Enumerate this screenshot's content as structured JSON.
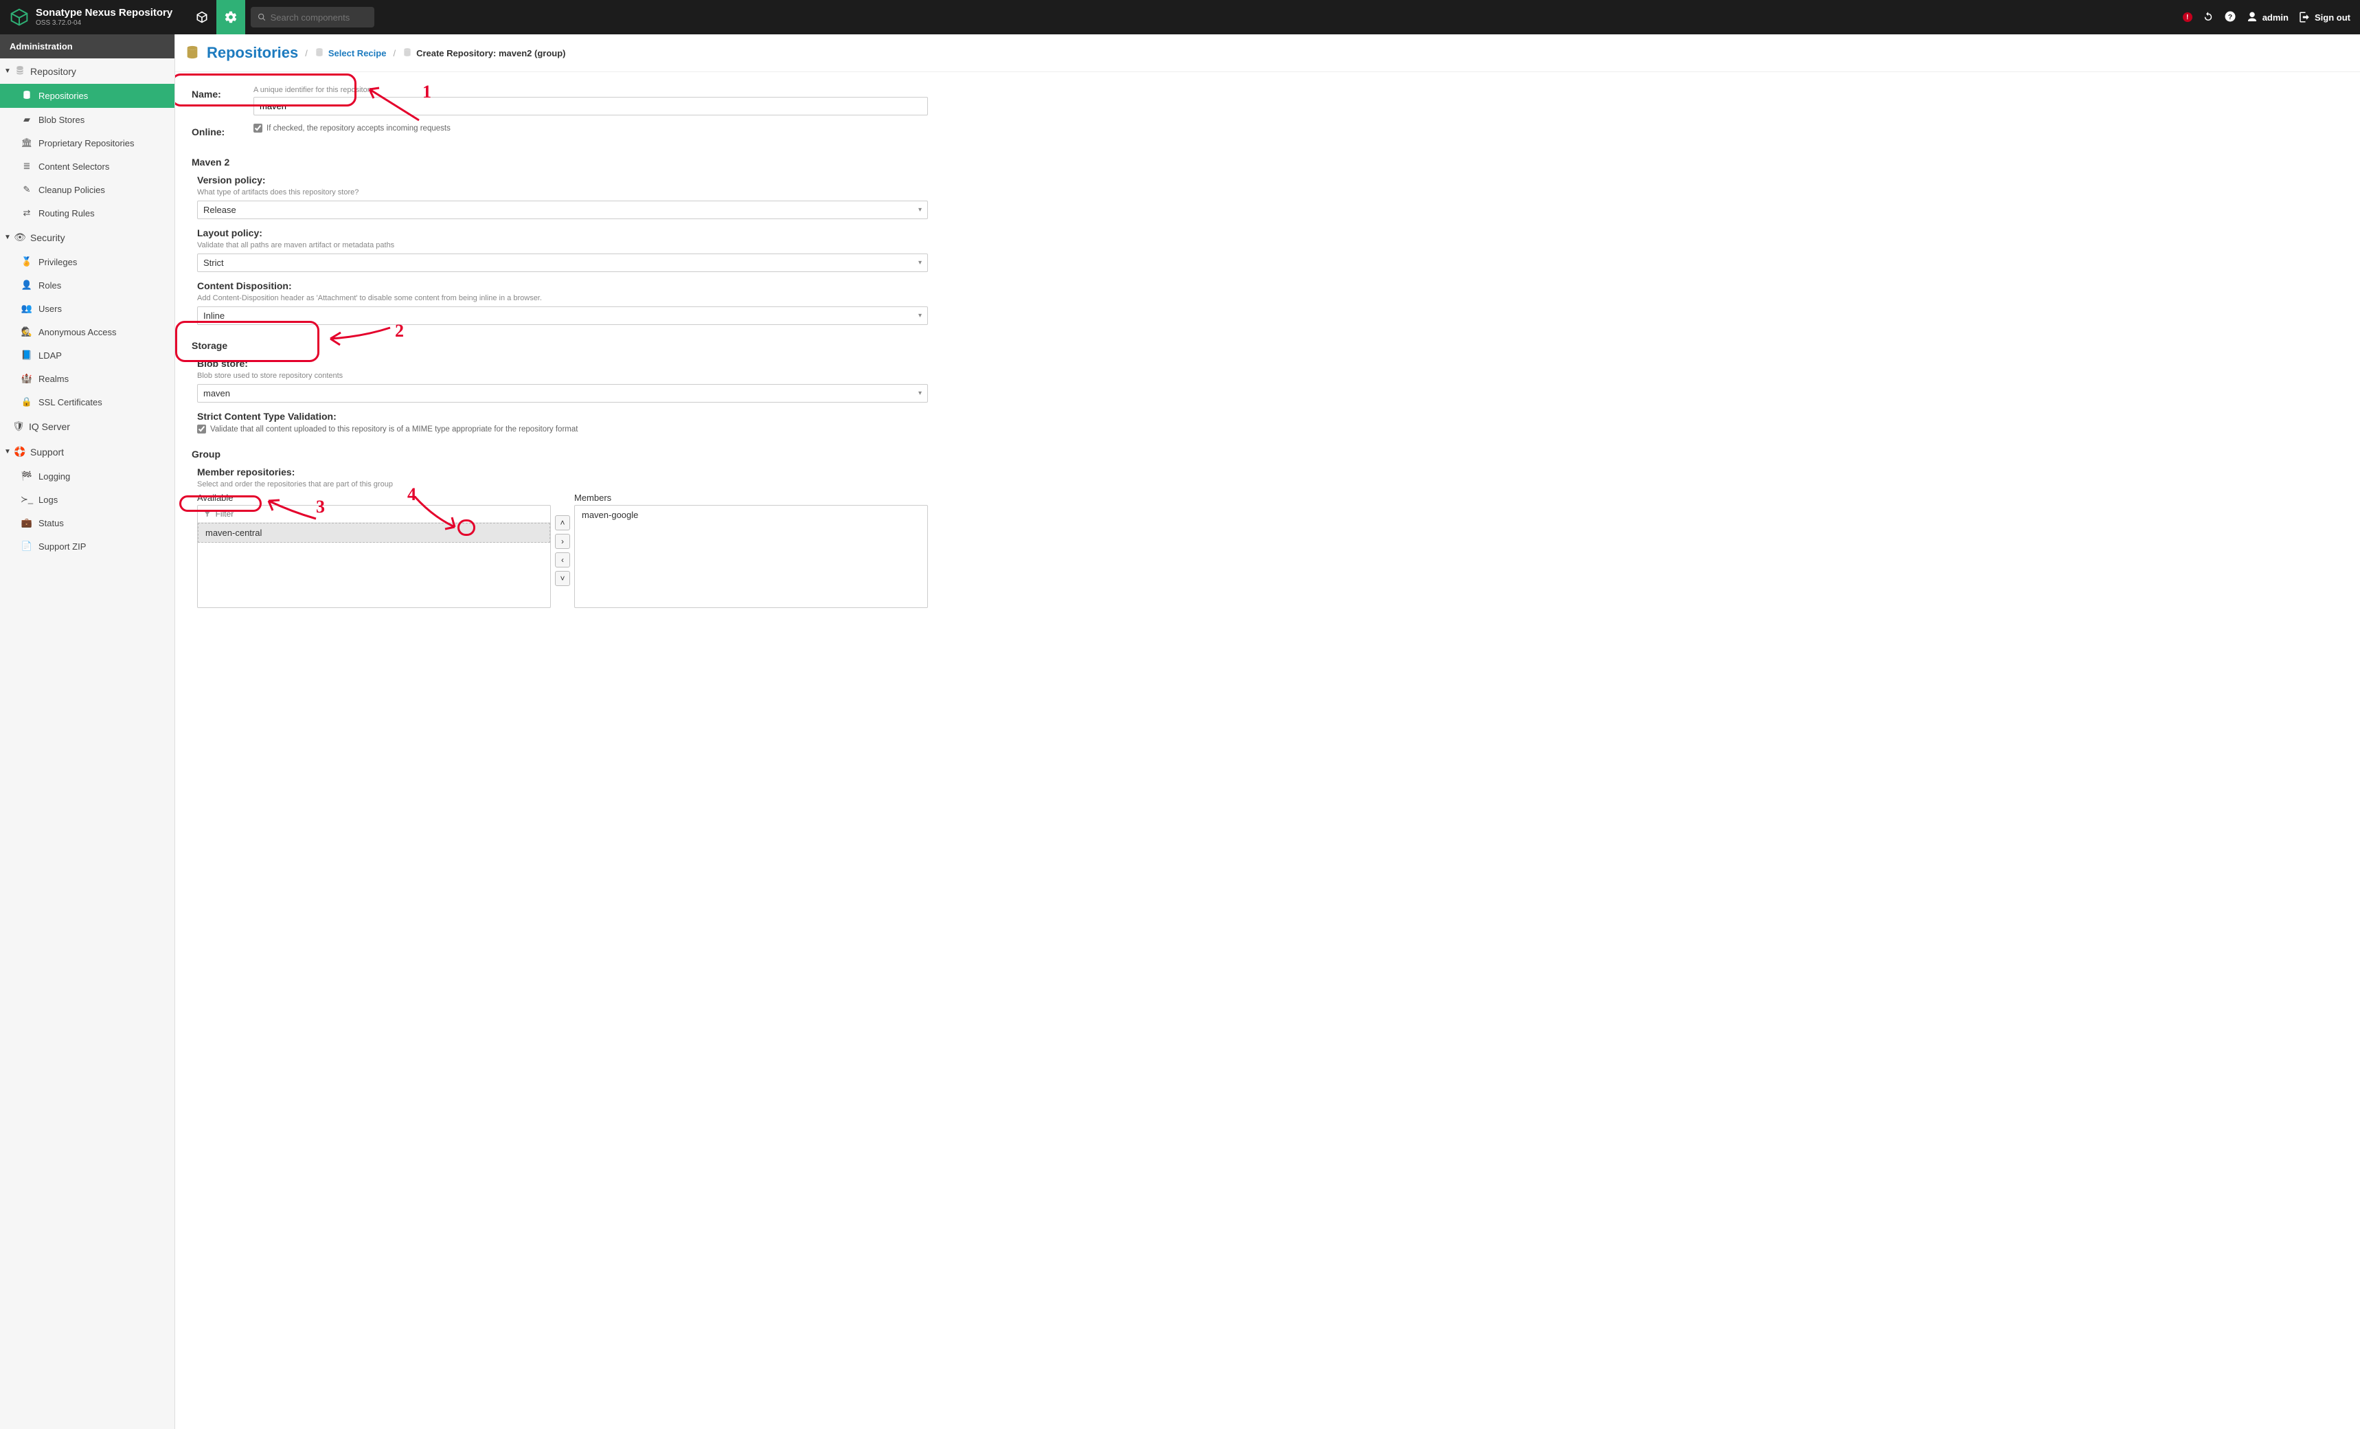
{
  "header": {
    "product_title": "Sonatype Nexus Repository",
    "product_version": "OSS 3.72.0-04",
    "search_placeholder": "Search components",
    "user_label": "admin",
    "signout_label": "Sign out"
  },
  "sidebar": {
    "title": "Administration",
    "groups": [
      {
        "label": "Repository",
        "expanded": true,
        "items": [
          {
            "id": "repositories",
            "label": "Repositories",
            "active": true
          },
          {
            "id": "blob-stores",
            "label": "Blob Stores"
          },
          {
            "id": "proprietary",
            "label": "Proprietary Repositories"
          },
          {
            "id": "content-sel",
            "label": "Content Selectors"
          },
          {
            "id": "cleanup",
            "label": "Cleanup Policies"
          },
          {
            "id": "routing",
            "label": "Routing Rules"
          }
        ]
      },
      {
        "label": "Security",
        "expanded": true,
        "items": [
          {
            "id": "privileges",
            "label": "Privileges"
          },
          {
            "id": "roles",
            "label": "Roles"
          },
          {
            "id": "users",
            "label": "Users"
          },
          {
            "id": "anon",
            "label": "Anonymous Access"
          },
          {
            "id": "ldap",
            "label": "LDAP"
          },
          {
            "id": "realms",
            "label": "Realms"
          },
          {
            "id": "sslcerts",
            "label": "SSL Certificates"
          }
        ]
      },
      {
        "label": "IQ Server",
        "expanded": false,
        "items": []
      },
      {
        "label": "Support",
        "expanded": true,
        "items": [
          {
            "id": "logging",
            "label": "Logging"
          },
          {
            "id": "logs",
            "label": "Logs"
          },
          {
            "id": "status",
            "label": "Status"
          },
          {
            "id": "support-zip",
            "label": "Support ZIP"
          }
        ]
      }
    ]
  },
  "breadcrumb": {
    "main": "Repositories",
    "crumb1": "Select Recipe",
    "crumb2": "Create Repository: maven2 (group)"
  },
  "form": {
    "name_label": "Name:",
    "name_hint": "A unique identifier for this repository",
    "name_value": "maven",
    "online_label": "Online:",
    "online_hint": "If checked, the repository accepts incoming requests",
    "maven_section": "Maven 2",
    "version_policy_label": "Version policy:",
    "version_policy_hint": "What type of artifacts does this repository store?",
    "version_policy_value": "Release",
    "layout_policy_label": "Layout policy:",
    "layout_policy_hint": "Validate that all paths are maven artifact or metadata paths",
    "layout_policy_value": "Strict",
    "content_disposition_label": "Content Disposition:",
    "content_disposition_hint": "Add Content-Disposition header as 'Attachment' to disable some content from being inline in a browser.",
    "content_disposition_value": "Inline",
    "storage_section": "Storage",
    "blob_store_label": "Blob store:",
    "blob_store_hint": "Blob store used to store repository contents",
    "blob_store_value": "maven",
    "strict_ct_label": "Strict Content Type Validation:",
    "strict_ct_hint": "Validate that all content uploaded to this repository is of a MIME type appropriate for the repository format",
    "group_section": "Group",
    "members_label": "Member repositories:",
    "members_hint": "Select and order the repositories that are part of this group",
    "available_label": "Available",
    "members_col_label": "Members",
    "filter_placeholder": "Filter",
    "available_items": [
      "maven-central"
    ],
    "member_items": [
      "maven-google"
    ]
  },
  "annotations": {
    "n1": "1",
    "n2": "2",
    "n3": "3",
    "n4": "4"
  }
}
